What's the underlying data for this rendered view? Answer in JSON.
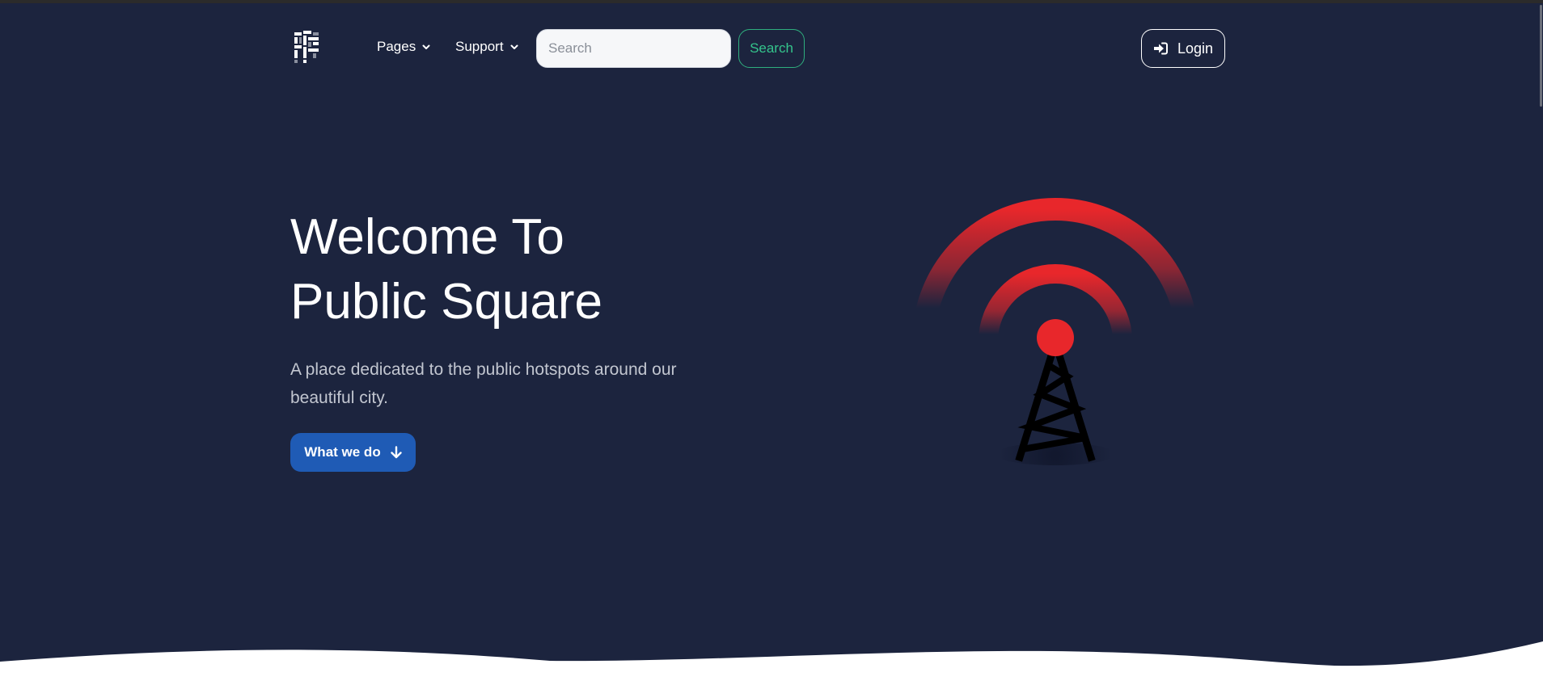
{
  "navbar": {
    "pages_label": "Pages",
    "support_label": "Support",
    "search_placeholder": "Search",
    "search_value": "",
    "search_button_label": "Search",
    "login_label": "Login"
  },
  "hero": {
    "title_line1": "Welcome To",
    "title_line2": "Public Square",
    "subtitle": "A place dedicated to the public hotspots around our beautiful city.",
    "cta_label": "What we do"
  },
  "colors": {
    "background": "#1c243e",
    "accent_green": "#34c48c",
    "cta_blue": "#1f5bb5",
    "signal_red": "#e8272b"
  },
  "icons": {
    "logo": "logo-icon",
    "dropdown": "chevron-down-icon",
    "login": "sign-in-icon",
    "cta": "arrow-down-icon",
    "illustration": "radio-tower-icon"
  }
}
